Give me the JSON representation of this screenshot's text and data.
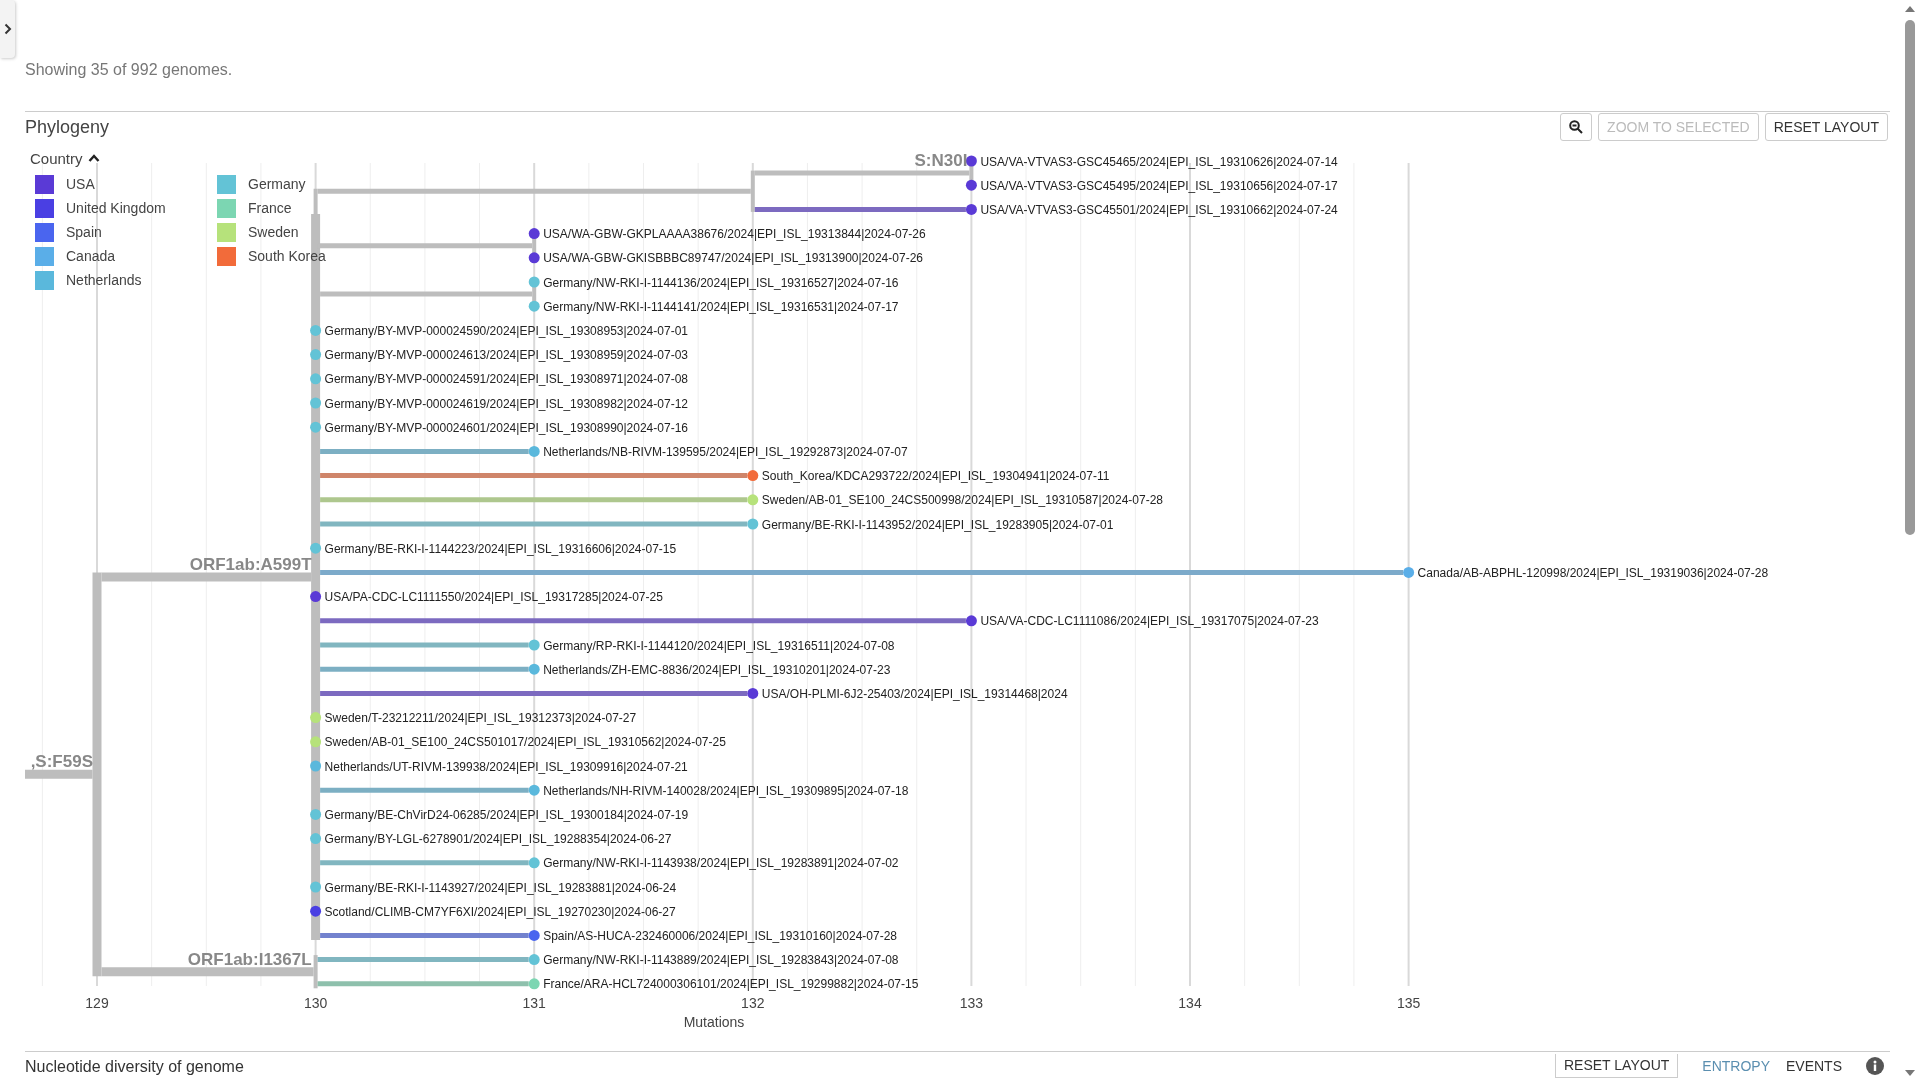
{
  "summary": "Showing 35 of 992 genomes.",
  "phylogeny": {
    "title": "Phylogeny",
    "buttons": [
      {
        "label": "ZOOM TO SELECTED",
        "disabled": true
      },
      {
        "label": "RESET LAYOUT",
        "disabled": false
      }
    ]
  },
  "legend": {
    "title": "Country",
    "expanded": true,
    "items": [
      {
        "label": "USA",
        "color": "#5a3ad6"
      },
      {
        "label": "United Kingdom",
        "color": "#4a3fe3"
      },
      {
        "label": "Spain",
        "color": "#4a65ef"
      },
      {
        "label": "Canada",
        "color": "#5aaee8"
      },
      {
        "label": "Netherlands",
        "color": "#5ab8dc"
      },
      {
        "label": "Germany",
        "color": "#63c3d6"
      },
      {
        "label": "France",
        "color": "#7cd6b2"
      },
      {
        "label": "Sweden",
        "color": "#b6e27b"
      },
      {
        "label": "South Korea",
        "color": "#f26b3a"
      }
    ]
  },
  "axis": {
    "title": "Mutations",
    "ticks": [
      "129",
      "130",
      "131",
      "132",
      "133",
      "134",
      "135"
    ]
  },
  "tree": {
    "label": ",S:F59S",
    "children": [
      {
        "label": "ORF1ab:A599T",
        "children": [
          {
            "children": [
              {
                "children": [
                  {
                    "label": "S:N30I",
                    "children": [
                      {
                        "name": "USA/VA-VTVAS3-GSC45465/2024|EPI_ISL_19310626|2024-07-14",
                        "color": "#5a3ad6"
                      },
                      {
                        "name": "USA/VA-VTVAS3-GSC45495/2024|EPI_ISL_19310656|2024-07-17",
                        "color": "#5a3ad6"
                      }
                    ]
                  },
                  {
                    "name": "USA/VA-VTVAS3-GSC45501/2024|EPI_ISL_19310662|2024-07-24",
                    "color": "#5a3ad6"
                  }
                ]
              },
              {
                "children": [
                  {
                    "name": "USA/WA-GBW-GKPLAAAA38676/2024|EPI_ISL_19313844|2024-07-26",
                    "color": "#5a3ad6"
                  },
                  {
                    "name": "USA/WA-GBW-GKISBBBC89747/2024|EPI_ISL_19313900|2024-07-26",
                    "color": "#5a3ad6"
                  }
                ]
              }
            ]
          },
          {
            "children": [
              {
                "name": "Germany/NW-RKI-I-1144136/2024|EPI_ISL_19316527|2024-07-16",
                "color": "#63c3d6"
              },
              {
                "name": "Germany/NW-RKI-I-1144141/2024|EPI_ISL_19316531|2024-07-17",
                "color": "#63c3d6"
              }
            ]
          },
          {
            "name": "Germany/BY-MVP-000024590/2024|EPI_ISL_19308953|2024-07-01",
            "color": "#63c3d6"
          },
          {
            "name": "Germany/BY-MVP-000024613/2024|EPI_ISL_19308959|2024-07-03",
            "color": "#63c3d6"
          },
          {
            "name": "Germany/BY-MVP-000024591/2024|EPI_ISL_19308971|2024-07-08",
            "color": "#63c3d6"
          },
          {
            "name": "Germany/BY-MVP-000024619/2024|EPI_ISL_19308982|2024-07-12",
            "color": "#63c3d6"
          },
          {
            "name": "Germany/BY-MVP-000024601/2024|EPI_ISL_19308990|2024-07-16",
            "color": "#63c3d6"
          },
          {
            "name": "Netherlands/NB-RIVM-139595/2024|EPI_ISL_19292873|2024-07-07",
            "color": "#5ab8dc"
          },
          {
            "name": "South_Korea/KDCA293722/2024|EPI_ISL_19304941|2024-07-11",
            "color": "#f26b3a"
          },
          {
            "name": "Sweden/AB-01_SE100_24CS500998/2024|EPI_ISL_19310587|2024-07-28",
            "color": "#b6e27b"
          },
          {
            "name": "Germany/BE-RKI-I-1143952/2024|EPI_ISL_19283905|2024-07-01",
            "color": "#63c3d6"
          },
          {
            "name": "Germany/BE-RKI-I-1144223/2024|EPI_ISL_19316606|2024-07-15",
            "color": "#63c3d6"
          },
          {
            "name": "Canada/AB-ABPHL-120998/2024|EPI_ISL_19319036|2024-07-28",
            "color": "#5aaee8"
          },
          {
            "name": "USA/PA-CDC-LC1111550/2024|EPI_ISL_19317285|2024-07-25",
            "color": "#5a3ad6"
          },
          {
            "name": "USA/VA-CDC-LC1111086/2024|EPI_ISL_19317075|2024-07-23",
            "color": "#5a3ad6"
          },
          {
            "name": "Germany/RP-RKI-I-1144120/2024|EPI_ISL_19316511|2024-07-08",
            "color": "#63c3d6"
          },
          {
            "name": "Netherlands/ZH-EMC-8836/2024|EPI_ISL_19310201|2024-07-23",
            "color": "#5ab8dc"
          },
          {
            "name": "USA/OH-PLMI-6J2-25403/2024|EPI_ISL_19314468|2024",
            "color": "#5a3ad6"
          },
          {
            "name": "Sweden/T-23212211/2024|EPI_ISL_19312373|2024-07-27",
            "color": "#b6e27b"
          },
          {
            "name": "Sweden/AB-01_SE100_24CS501017/2024|EPI_ISL_19310562|2024-07-25",
            "color": "#b6e27b"
          },
          {
            "name": "Netherlands/UT-RIVM-139938/2024|EPI_ISL_19309916|2024-07-21",
            "color": "#5ab8dc"
          },
          {
            "name": "Netherlands/NH-RIVM-140028/2024|EPI_ISL_19309895|2024-07-18",
            "color": "#5ab8dc"
          },
          {
            "name": "Germany/BE-ChVirD24-06285/2024|EPI_ISL_19300184|2024-07-19",
            "color": "#63c3d6"
          },
          {
            "name": "Germany/BY-LGL-6278901/2024|EPI_ISL_19288354|2024-06-27",
            "color": "#63c3d6"
          },
          {
            "name": "Germany/NW-RKI-I-1143938/2024|EPI_ISL_19283891|2024-07-02",
            "color": "#63c3d6"
          },
          {
            "name": "Germany/BE-RKI-I-1143927/2024|EPI_ISL_19283881|2024-06-24",
            "color": "#63c3d6"
          },
          {
            "name": "Scotland/CLIMB-CM7YF6XI/2024|EPI_ISL_19270230|2024-06-27",
            "color": "#4a3fe3"
          },
          {
            "name": "Spain/AS-HUCA-232460006/2024|EPI_ISL_19310160|2024-07-28",
            "color": "#4a65ef"
          }
        ]
      },
      {
        "label": "ORF1ab:I1367L",
        "children": [
          {
            "name": "Germany/NW-RKI-I-1143889/2024|EPI_ISL_19283843|2024-07-08",
            "color": "#63c3d6"
          },
          {
            "name": "France/ARA-HCL724000306101/2024|EPI_ISL_19299882|2024-07-15",
            "color": "#7cd6b2"
          }
        ]
      }
    ]
  },
  "footer": {
    "title": "Nucleotide diversity of genome",
    "buttons": [
      {
        "label": "RESET LAYOUT",
        "disabled": false
      }
    ],
    "tabs": [
      {
        "label": "ENTROPY",
        "selected": true
      },
      {
        "label": "EVENTS",
        "selected": false
      }
    ]
  }
}
